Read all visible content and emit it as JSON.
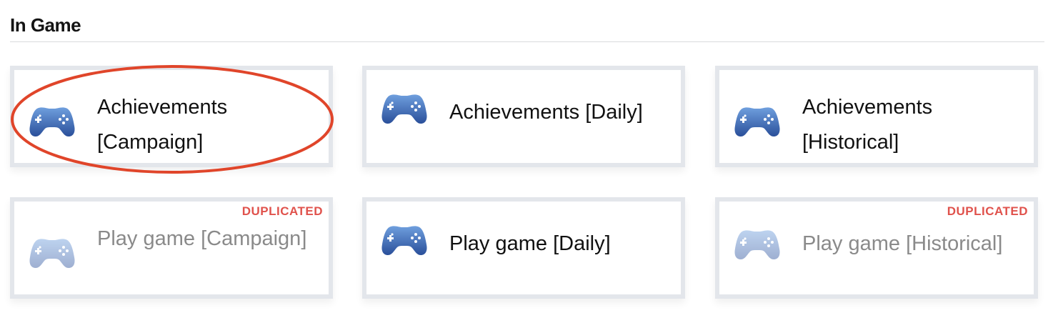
{
  "section": {
    "title": "In Game"
  },
  "cards": [
    {
      "label": "Achievements [Campaign]",
      "icon": "gamepad-icon",
      "badge": ""
    },
    {
      "label": "Achievements [Daily]",
      "icon": "gamepad-icon",
      "badge": ""
    },
    {
      "label": "Achievements [Historical]",
      "icon": "gamepad-icon",
      "badge": ""
    },
    {
      "label": "Play game [Campaign]",
      "icon": "gamepad-icon",
      "badge": "DUPLICATED"
    },
    {
      "label": "Play game [Daily]",
      "icon": "gamepad-icon",
      "badge": ""
    },
    {
      "label": "Play game [Historical]",
      "icon": "gamepad-icon",
      "badge": "DUPLICATED"
    }
  ],
  "colors": {
    "badge": "#e0524c",
    "highlight": "#e0452a",
    "icon_light": "#6f9fde",
    "icon_dark": "#2a4f9a",
    "card_border": "#e3e6eb"
  }
}
